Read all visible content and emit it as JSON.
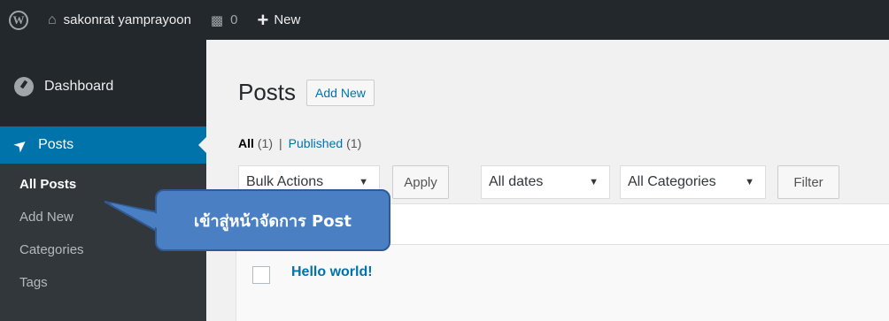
{
  "adminbar": {
    "site_name": "sakonrat yamprayoon",
    "comments_count": "0",
    "new_label": "New",
    "icons": {
      "logo": "wordpress-icon",
      "home": "home-icon",
      "comments": "comment-icon",
      "new": "plus-icon"
    }
  },
  "sidebar": {
    "dashboard_label": "Dashboard",
    "posts_label": "Posts",
    "submenu": [
      "All Posts",
      "Add New",
      "Categories",
      "Tags"
    ]
  },
  "main": {
    "page_title": "Posts",
    "add_new_button": "Add New",
    "filter_all": "All",
    "filter_all_count": "(1)",
    "filter_separator": "|",
    "filter_published": "Published",
    "filter_published_count": "(1)",
    "bulk_actions": "Bulk Actions",
    "apply_button": "Apply",
    "dates_select": "All dates",
    "categories_select": "All Categories",
    "filter_button": "Filter",
    "post_title": "Hello world!"
  },
  "callout": {
    "text": "เข้าสู่หน้าจัดการ Post"
  },
  "colors": {
    "adminbar_bg": "#23282d",
    "active_menu": "#0073aa",
    "callout_fill": "#4a80c3",
    "link": "#0073aa"
  }
}
